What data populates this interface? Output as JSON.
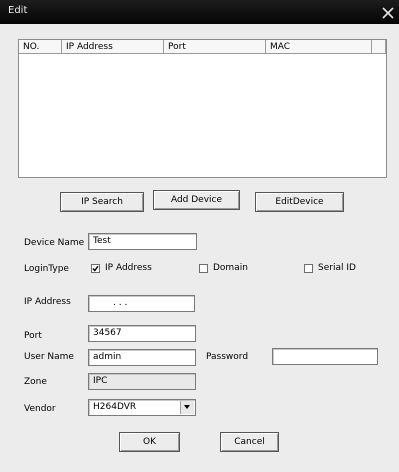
{
  "window": {
    "title": "Edit"
  },
  "list": {
    "columns": [
      "NO.",
      "IP Address",
      "Port",
      "MAC"
    ]
  },
  "buttons": {
    "ip_search": "IP Search",
    "add_device": "Add Device",
    "edit_device": "EditDevice",
    "ok": "OK",
    "cancel": "Cancel"
  },
  "form": {
    "device_name_label": "Device Name",
    "device_name_value": "Test",
    "login_type_label": "LoginType",
    "login_options": [
      {
        "label": "IP Address",
        "checked": true
      },
      {
        "label": "Domain",
        "checked": false
      },
      {
        "label": "Serial ID",
        "checked": false
      }
    ],
    "ip_address_label": "IP Address",
    "ip_address_value": ".     .     .",
    "port_label": "Port",
    "port_value": "34567",
    "user_name_label": "User Name",
    "user_name_value": "admin",
    "password_label": "Password",
    "password_value": "",
    "zone_label": "Zone",
    "zone_value": "IPC",
    "vendor_label": "Vendor",
    "vendor_value": "H264DVR"
  },
  "colors": {
    "titlebar": "#0a0a0a",
    "background": "#ececec"
  }
}
